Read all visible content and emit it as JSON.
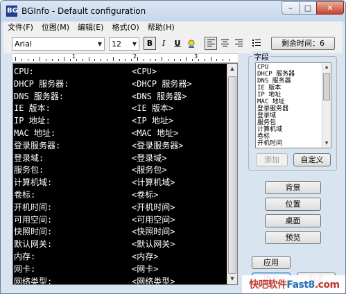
{
  "window": {
    "title": "BGInfo - Default configuration",
    "icon": "BG"
  },
  "titlebar_buttons": {
    "minimize": "–",
    "maximize": "□",
    "close": "✕"
  },
  "menu": [
    "文件(F)",
    "位图(M)",
    "编辑(E)",
    "格式(O)",
    "帮助(H)"
  ],
  "toolbar": {
    "font": "Arial",
    "size": "12",
    "bold": "B",
    "italic": "I",
    "underline": "U",
    "timer": "剩余时间：6"
  },
  "ruler": {
    "marks": [
      "1",
      "2",
      "3"
    ]
  },
  "editor": {
    "rows": [
      {
        "label": "CPU:",
        "token": "<CPU>"
      },
      {
        "label": "DHCP 服务器:",
        "token": "<DHCP 服务器>"
      },
      {
        "label": "DNS 服务器:",
        "token": "<DNS 服务器>"
      },
      {
        "label": "IE 版本:",
        "token": "<IE 版本>"
      },
      {
        "label": "IP 地址:",
        "token": "<IP 地址>"
      },
      {
        "label": "MAC 地址:",
        "token": "<MAC 地址>"
      },
      {
        "label": "登录服务器:",
        "token": "<登录服务器>"
      },
      {
        "label": "登录域:",
        "token": "<登录域>"
      },
      {
        "label": "服务包:",
        "token": "<服务包>"
      },
      {
        "label": "计算机域:",
        "token": "<计算机域>"
      },
      {
        "label": "卷标:",
        "token": "<卷标>"
      },
      {
        "label": "开机时间:",
        "token": "<开机时间>"
      },
      {
        "label": "可用空间:",
        "token": "<可用空间>"
      },
      {
        "label": "快照时间:",
        "token": "<快照时间>"
      },
      {
        "label": "默认网关:",
        "token": "<默认网关>"
      },
      {
        "label": "内存:",
        "token": "<内存>"
      },
      {
        "label": "网卡:",
        "token": "<网卡>"
      },
      {
        "label": "网络类型:",
        "token": "<网络类型>"
      }
    ]
  },
  "fields": {
    "group_label": "字段",
    "items": [
      "CPU",
      "DHCP 服务器",
      "DNS 服务器",
      "IE 版本",
      "IP 地址",
      "MAC 地址",
      "登录服务器",
      "登录域",
      "服务包",
      "计算机域",
      "卷标",
      "开机时间"
    ],
    "add_button": "添加",
    "custom_button": "自定义"
  },
  "side_buttons": {
    "background": "背景",
    "position": "位置",
    "desktop": "桌面",
    "preview": "预览",
    "apply": "应用",
    "ok": "确定",
    "cancel": "取消"
  },
  "watermark": {
    "part1": "快吧软件",
    "part2": "Fast8",
    "part3": ".com"
  }
}
